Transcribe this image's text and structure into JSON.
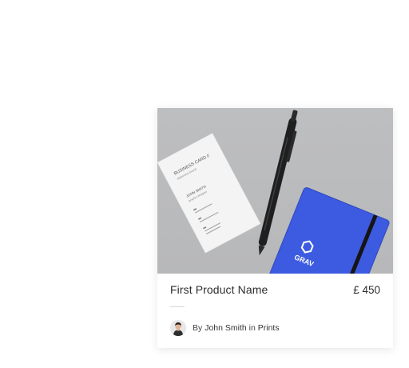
{
  "product": {
    "title": "First Product Name",
    "price": "£ 450",
    "image_icon": "product-mockup-image"
  },
  "byline": {
    "by": "By",
    "author": "John Smith",
    "in": "in",
    "category": "Prints"
  },
  "mockup_text": {
    "card_heading": "BUSINESS CARD //",
    "card_sub": "stationery brand",
    "card_name": "JOHN SMITH",
    "card_role": "graphic designer",
    "notebook_text": "GRAV"
  },
  "colors": {
    "notebook_blue": "#3d5be0",
    "pen_black": "#1f1f1f",
    "background_grey": "#bcbdbf"
  }
}
